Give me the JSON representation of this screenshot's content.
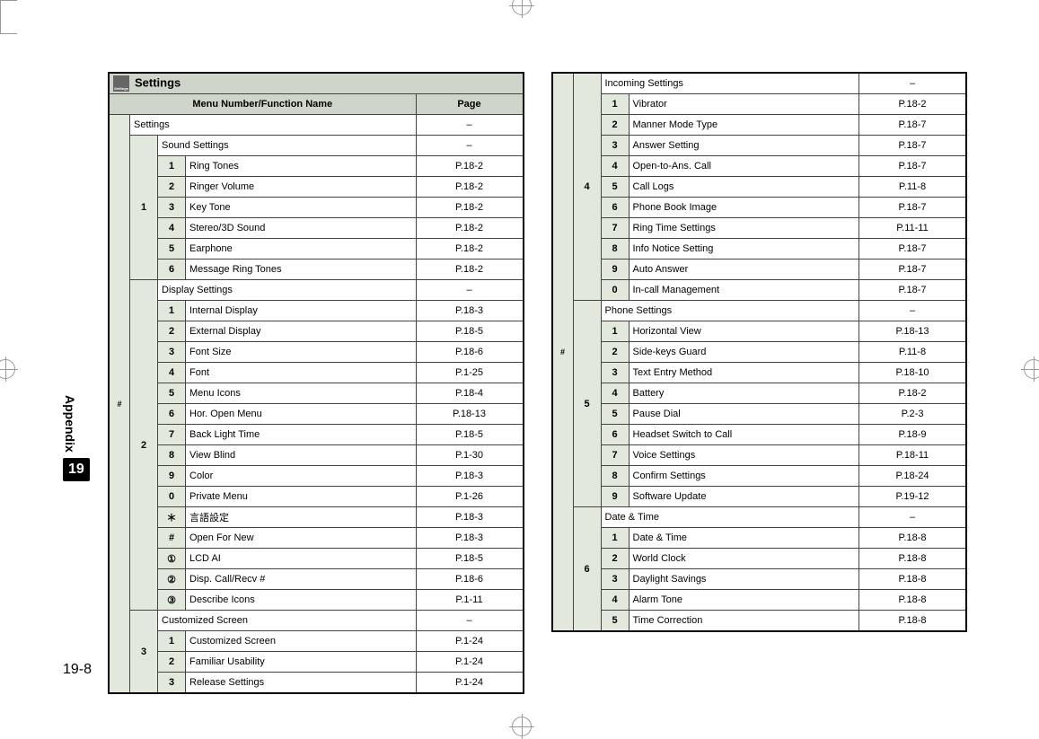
{
  "sidebar": {
    "label": "Appendix",
    "chapter": "19"
  },
  "pageNumber": "19-8",
  "leftTable": {
    "title": "Settings",
    "headerMenu": "Menu Number/Function Name",
    "headerPage": "Page",
    "hash": "#",
    "rootName": "Settings",
    "rootPage": "–",
    "sections": [
      {
        "num": "1",
        "name": "Sound Settings",
        "page": "–",
        "items": [
          {
            "num": "1",
            "name": "Ring Tones",
            "page": "P.18-2"
          },
          {
            "num": "2",
            "name": "Ringer Volume",
            "page": "P.18-2"
          },
          {
            "num": "3",
            "name": "Key Tone",
            "page": "P.18-2"
          },
          {
            "num": "4",
            "name": "Stereo/3D Sound",
            "page": "P.18-2"
          },
          {
            "num": "5",
            "name": "Earphone",
            "page": "P.18-2"
          },
          {
            "num": "6",
            "name": "Message Ring Tones",
            "page": "P.18-2"
          }
        ]
      },
      {
        "num": "2",
        "name": "Display Settings",
        "page": "–",
        "items": [
          {
            "num": "1",
            "name": "Internal Display",
            "page": "P.18-3"
          },
          {
            "num": "2",
            "name": "External Display",
            "page": "P.18-5"
          },
          {
            "num": "3",
            "name": "Font Size",
            "page": "P.18-6"
          },
          {
            "num": "4",
            "name": "Font",
            "page": "P.1-25"
          },
          {
            "num": "5",
            "name": "Menu Icons",
            "page": "P.18-4"
          },
          {
            "num": "6",
            "name": "Hor. Open Menu",
            "page": "P.18-13"
          },
          {
            "num": "7",
            "name": "Back Light Time",
            "page": "P.18-5"
          },
          {
            "num": "8",
            "name": "View Blind",
            "page": "P.1-30"
          },
          {
            "num": "9",
            "name": "Color",
            "page": "P.18-3"
          },
          {
            "num": "0",
            "name": "Private Menu",
            "page": "P.1-26"
          },
          {
            "num": "＊",
            "name": "言語設定",
            "page": "P.18-3"
          },
          {
            "num": "#",
            "name": "Open For New",
            "page": "P.18-3"
          },
          {
            "num": "①",
            "name": "LCD AI",
            "page": "P.18-5"
          },
          {
            "num": "②",
            "name": "Disp. Call/Recv #",
            "page": "P.18-6"
          },
          {
            "num": "③",
            "name": "Describe Icons",
            "page": "P.1-11"
          }
        ]
      },
      {
        "num": "3",
        "name": "Customized Screen",
        "page": "–",
        "items": [
          {
            "num": "1",
            "name": "Customized Screen",
            "page": "P.1-24"
          },
          {
            "num": "2",
            "name": "Familiar Usability",
            "page": "P.1-24"
          },
          {
            "num": "3",
            "name": "Release Settings",
            "page": "P.1-24"
          }
        ]
      }
    ]
  },
  "rightTable": {
    "hash": "#",
    "sections": [
      {
        "num": "4",
        "name": "Incoming Settings",
        "page": "–",
        "items": [
          {
            "num": "1",
            "name": "Vibrator",
            "page": "P.18-2"
          },
          {
            "num": "2",
            "name": "Manner Mode Type",
            "page": "P.18-7"
          },
          {
            "num": "3",
            "name": "Answer Setting",
            "page": "P.18-7"
          },
          {
            "num": "4",
            "name": "Open-to-Ans. Call",
            "page": "P.18-7"
          },
          {
            "num": "5",
            "name": "Call Logs",
            "page": "P.11-8"
          },
          {
            "num": "6",
            "name": "Phone Book Image",
            "page": "P.18-7"
          },
          {
            "num": "7",
            "name": "Ring Time Settings",
            "page": "P.11-11"
          },
          {
            "num": "8",
            "name": "Info Notice Setting",
            "page": "P.18-7"
          },
          {
            "num": "9",
            "name": "Auto Answer",
            "page": "P.18-7"
          },
          {
            "num": "0",
            "name": "In-call Management",
            "page": "P.18-7"
          }
        ]
      },
      {
        "num": "5",
        "name": "Phone Settings",
        "page": "–",
        "items": [
          {
            "num": "1",
            "name": "Horizontal View",
            "page": "P.18-13"
          },
          {
            "num": "2",
            "name": "Side-keys Guard",
            "page": "P.11-8"
          },
          {
            "num": "3",
            "name": "Text Entry Method",
            "page": "P.18-10"
          },
          {
            "num": "4",
            "name": "Battery",
            "page": "P.18-2"
          },
          {
            "num": "5",
            "name": "Pause Dial",
            "page": "P.2-3"
          },
          {
            "num": "6",
            "name": "Headset Switch to Call",
            "page": "P.18-9"
          },
          {
            "num": "7",
            "name": "Voice Settings",
            "page": "P.18-11"
          },
          {
            "num": "8",
            "name": "Confirm Settings",
            "page": "P.18-24"
          },
          {
            "num": "9",
            "name": "Software Update",
            "page": "P.19-12"
          }
        ]
      },
      {
        "num": "6",
        "name": "Date & Time",
        "page": "–",
        "items": [
          {
            "num": "1",
            "name": "Date & Time",
            "page": "P.18-8"
          },
          {
            "num": "2",
            "name": "World Clock",
            "page": "P.18-8"
          },
          {
            "num": "3",
            "name": "Daylight Savings",
            "page": "P.18-8"
          },
          {
            "num": "4",
            "name": "Alarm Tone",
            "page": "P.18-8"
          },
          {
            "num": "5",
            "name": "Time Correction",
            "page": "P.18-8"
          }
        ]
      }
    ]
  }
}
